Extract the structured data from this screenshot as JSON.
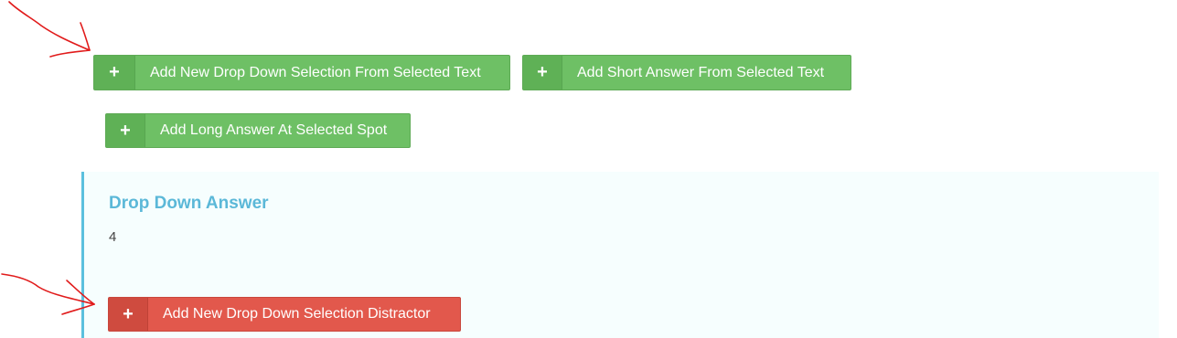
{
  "buttons": {
    "add_dropdown": {
      "icon": "plus-icon",
      "label": "Add New Drop Down Selection From Selected Text"
    },
    "add_short_answer": {
      "icon": "plus-icon",
      "label": "Add Short Answer From Selected Text"
    },
    "add_long_answer": {
      "icon": "plus-icon",
      "label": "Add Long Answer At Selected Spot"
    }
  },
  "answer_panel": {
    "title": "Drop Down Answer",
    "value": "4",
    "distractor_button": {
      "icon": "plus-icon",
      "label": "Add New Drop Down Selection Distractor"
    }
  },
  "colors": {
    "green": "#6ec065",
    "red": "#e2584c",
    "info_blue": "#5bc0de",
    "annotation_red": "#e11b1b"
  }
}
